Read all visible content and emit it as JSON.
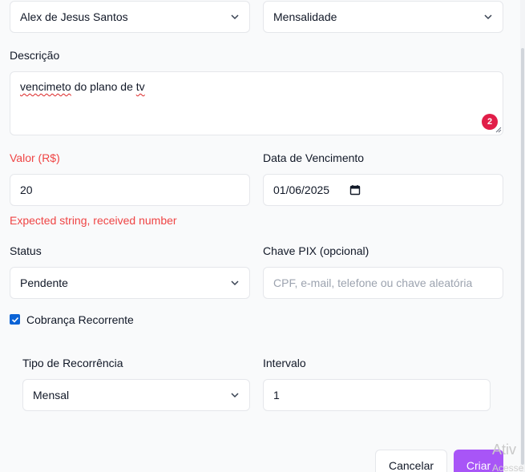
{
  "form": {
    "client_select": {
      "value": "Alex de Jesus Santos"
    },
    "type_select": {
      "value": "Mensalidade"
    },
    "description": {
      "label": "Descrição",
      "value_misspelled": "vencimeto",
      "value_mid": " do plano de ",
      "value_end": "tv",
      "badge": "2"
    },
    "valor": {
      "label": "Valor (R$)",
      "value": "20",
      "error": "Expected string, received number"
    },
    "due_date": {
      "label": "Data de Vencimento",
      "value": "01/06/2025"
    },
    "status": {
      "label": "Status",
      "value": "Pendente"
    },
    "pix": {
      "label": "Chave PIX (opcional)",
      "placeholder": "CPF, e-mail, telefone ou chave aleatória"
    },
    "recurring": {
      "label": "Cobrança Recorrente",
      "checked": true
    },
    "recurrence_type": {
      "label": "Tipo de Recorrência",
      "value": "Mensal"
    },
    "interval": {
      "label": "Intervalo",
      "value": "1"
    }
  },
  "actions": {
    "cancel_label": "Cancelar",
    "create_label": "Criar"
  },
  "watermark": {
    "line1": "Ativ",
    "line2": "Acesse"
  },
  "colors": {
    "error": "#ef4444",
    "accent": "#a855f7",
    "checkbox": "#0b63d6",
    "badge": "#e11d48"
  }
}
